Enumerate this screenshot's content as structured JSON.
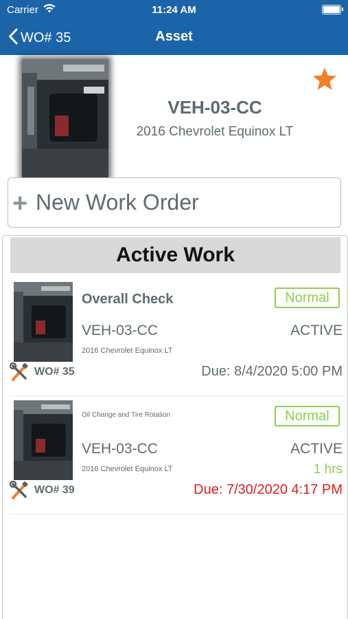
{
  "status_bar": {
    "carrier": "Carrier",
    "time": "11:24 AM"
  },
  "nav": {
    "back_label": "WO# 35",
    "title": "Asset",
    "color": "#1b64a8"
  },
  "asset": {
    "id": "VEH-03-CC",
    "description": "2016 Chevrolet Equinox LT",
    "favorite": true,
    "star_color": "#f0812b",
    "photo_icon": "vehicle-photo"
  },
  "new_work_order": {
    "plus": "+",
    "label": "New Work Order"
  },
  "active_work": {
    "heading": "Active Work",
    "items": [
      {
        "title": "Overall Check",
        "priority": "Normal",
        "asset_id": "VEH-03-CC",
        "status": "ACTIVE",
        "hours": "",
        "description": "2016 Chevrolet Equinox LT",
        "wo_number": "WO# 35",
        "due": "Due: 8/4/2020 5:00 PM",
        "overdue": false
      },
      {
        "title": "Oil Change and Tire Rotation",
        "priority": "Normal",
        "asset_id": "VEH-03-CC",
        "status": "ACTIVE",
        "hours": "1 hrs",
        "description": "2016 Chevrolet Equinox LT",
        "wo_number": "WO# 39",
        "due": "Due: 7/30/2020 4:17 PM",
        "overdue": true
      }
    ]
  },
  "colors": {
    "priority_normal": "#8ccf4d",
    "overdue": "#e01e1e",
    "text": "#5f6b70"
  }
}
